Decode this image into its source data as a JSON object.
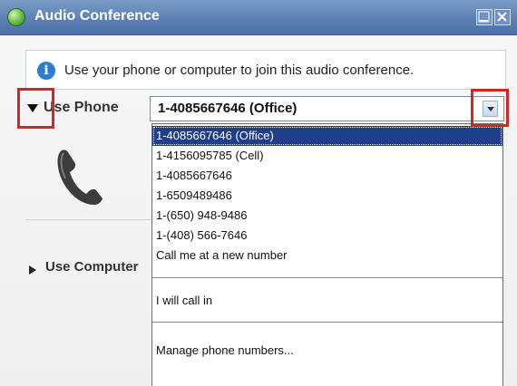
{
  "window": {
    "title": "Audio Conference",
    "icon": "globe-icon",
    "controls": [
      "minimize-icon",
      "close-icon"
    ]
  },
  "info": {
    "icon": "info-icon",
    "text": "Use your phone or computer to join this audio conference."
  },
  "phone_section": {
    "label": "Use Phone",
    "expanded": true,
    "selected_value": "1-4085667646 (Office)"
  },
  "phone_options": [
    "1-4085667646 (Office)",
    "1-4156095785 (Cell)",
    "1-4085667646",
    "1-6509489486",
    "1-(650) 948-9486",
    "1-(408) 566-7646",
    "Call me at a new number"
  ],
  "call_in_option": "I will call in",
  "manage_option": "Manage phone numbers...",
  "computer_section": {
    "label": "Use Computer",
    "expanded": false
  },
  "colors": {
    "titlebar": "#5d80b4",
    "selection": "#1f3f8c",
    "highlight_box": "#d42424"
  }
}
